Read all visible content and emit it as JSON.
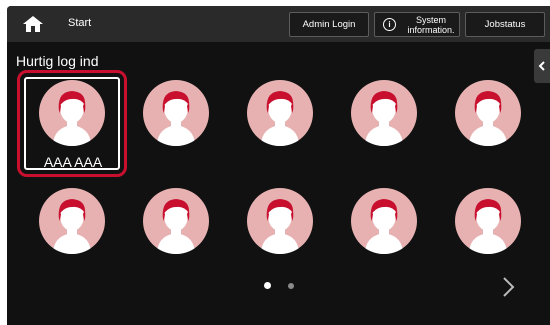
{
  "topbar": {
    "home_icon": "home-icon",
    "start_label": "Start",
    "admin_login_label": "Admin Login",
    "system_info_label": "System information.",
    "system_info_icon": "info-icon",
    "jobstatus_label": "Jobstatus"
  },
  "section_title": "Hurtig log ind",
  "side_tab_icon": "chevron-left-icon",
  "users": [
    {
      "label": "AAA AAA",
      "selected": true
    }
  ],
  "avatar_icon": "user-avatar-icon",
  "pagination": {
    "pages": 2,
    "current": 1
  },
  "next_icon": "chevron-right-icon",
  "colors": {
    "background": "#111111",
    "topbar": "#2a2a2a",
    "avatar_bg": "#e7b1b2",
    "avatar_hair": "#c8102e",
    "selection": "#c8102e"
  }
}
